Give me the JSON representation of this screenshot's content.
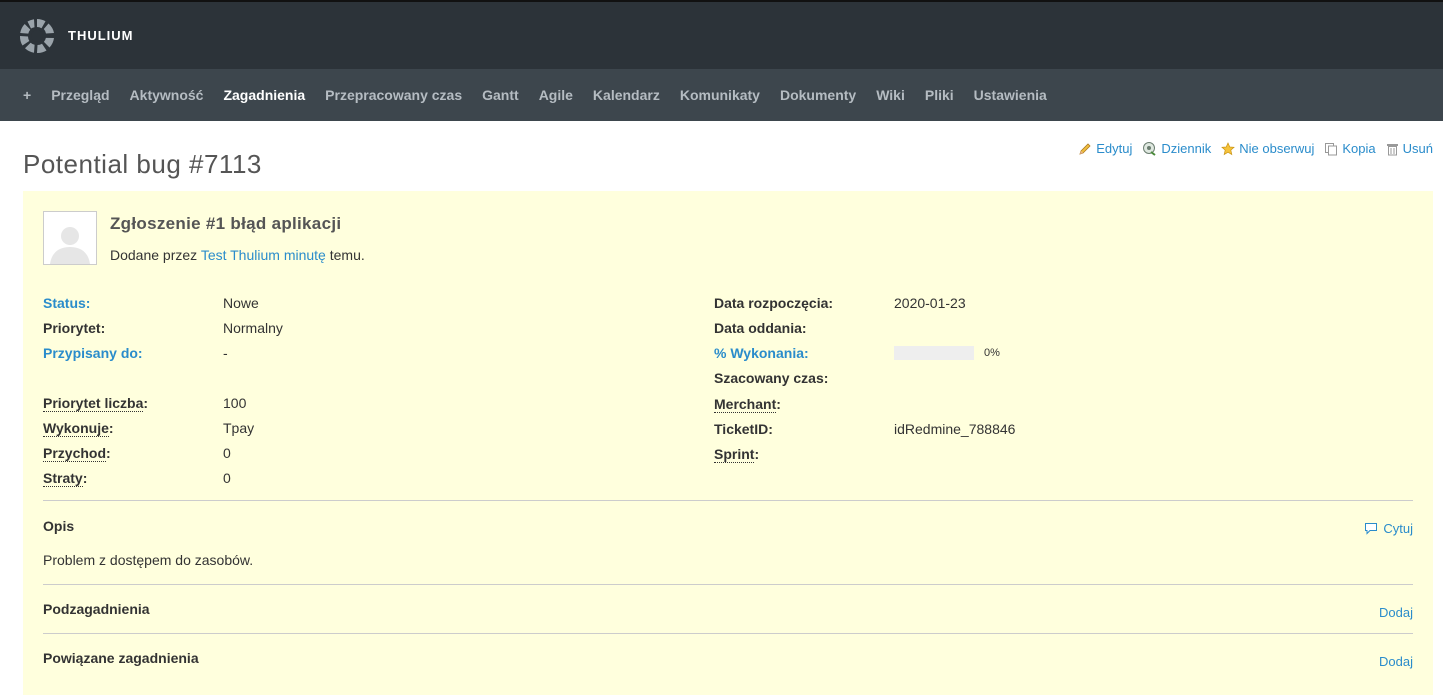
{
  "app": {
    "brand": "THULIUM"
  },
  "menu": {
    "plus": "+",
    "items": [
      "Przegląd",
      "Aktywność",
      "Zagadnienia",
      "Przepracowany czas",
      "Gantt",
      "Agile",
      "Kalendarz",
      "Komunikaty",
      "Dokumenty",
      "Wiki",
      "Pliki",
      "Ustawienia"
    ],
    "selected": "Zagadnienia"
  },
  "actions": {
    "edit": "Edytuj",
    "journal": "Dziennik",
    "unwatch": "Nie obserwuj",
    "copy": "Kopia",
    "delete": "Usuń"
  },
  "issue": {
    "title": "Potential bug #7113",
    "subject": "Zgłoszenie #1 błąd aplikacji",
    "author_prefix": "Dodane przez ",
    "author": "Test Thulium",
    "author_space": " ",
    "time": "minutę",
    "author_suffix": " temu.",
    "left": [
      {
        "label": "Status:",
        "value": "Nowe"
      },
      {
        "label": "Priorytet:",
        "value": "Normalny"
      },
      {
        "label": "Przypisany do:",
        "value": "-"
      },
      {
        "label": "Priorytet liczba",
        "value": "100"
      },
      {
        "label": "Wykonuje",
        "value": "Tpay"
      },
      {
        "label": "Przychod",
        "value": "0"
      },
      {
        "label": "Straty",
        "value": "0"
      }
    ],
    "right": [
      {
        "label": "Data rozpoczęcia:",
        "value": "2020-01-23"
      },
      {
        "label": "Data oddania:",
        "value": ""
      },
      {
        "label": "% Wykonania:",
        "value": "0%",
        "progress": 0
      },
      {
        "label": "Szacowany czas:",
        "value": ""
      },
      {
        "label": "Merchant",
        "value": ""
      },
      {
        "label": "TicketID:",
        "value": "idRedmine_788846"
      },
      {
        "label": "Sprint",
        "value": ""
      }
    ],
    "colon": ":",
    "description_title": "Opis",
    "quote": "Cytuj",
    "description": "Problem z dostępem do zasobów.",
    "subtasks_title": "Podzagadnienia",
    "related_title": "Powiązane zagadnienia",
    "add": "Dodaj"
  }
}
